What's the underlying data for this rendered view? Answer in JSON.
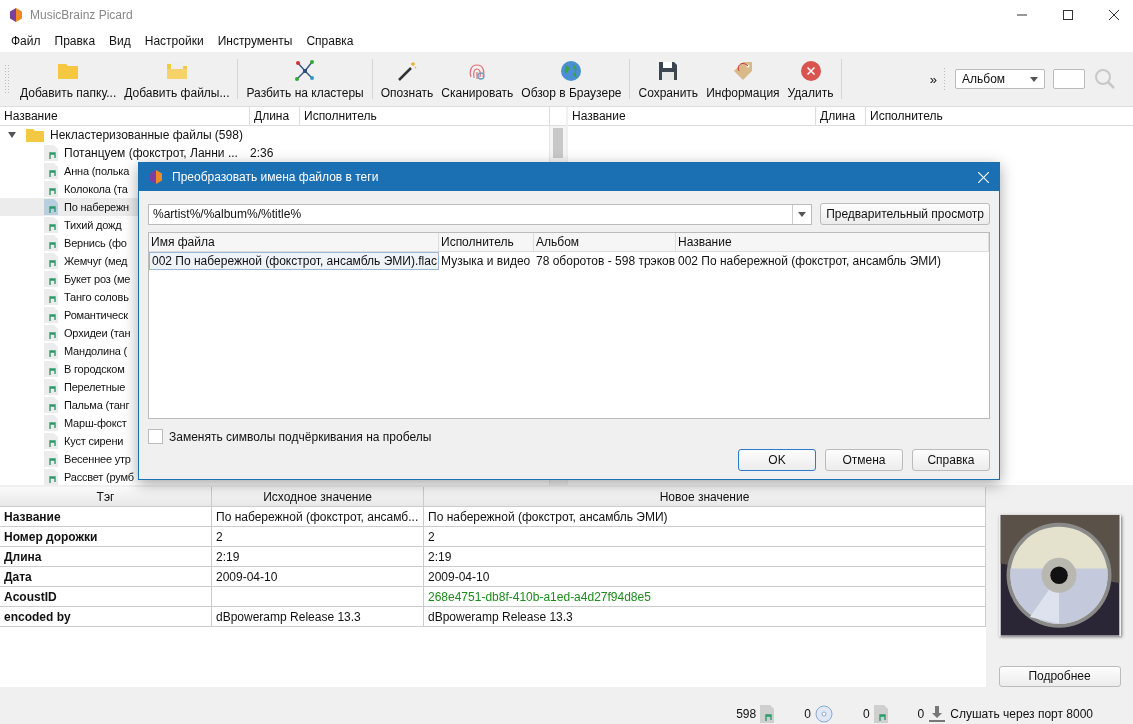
{
  "window": {
    "title": "MusicBrainz Picard"
  },
  "menu": [
    "Файл",
    "Правка",
    "Вид",
    "Настройки",
    "Инструменты",
    "Справка"
  ],
  "toolbar": [
    {
      "label": "Добавить папку...",
      "kind": "folder"
    },
    {
      "label": "Добавить файлы...",
      "kind": "files"
    },
    {
      "label": "Разбить на кластеры",
      "kind": "cluster"
    },
    {
      "label": "Опознать",
      "kind": "wand"
    },
    {
      "label": "Сканировать",
      "kind": "fingerprint"
    },
    {
      "label": "Обзор в Браузере",
      "kind": "globe"
    },
    {
      "label": "Сохранить",
      "kind": "save"
    },
    {
      "label": "Информация",
      "kind": "tag"
    },
    {
      "label": "Удалить",
      "kind": "remove"
    }
  ],
  "search": {
    "more": "»",
    "mode": "Альбом"
  },
  "left_pane": {
    "columns": [
      "Название",
      "Длина",
      "Исполнитель"
    ],
    "tree": {
      "label": "Некластеризованные файлы (598)",
      "expanded": true,
      "children": [
        {
          "title": "Потанцуем (фокстрот, Ланни ...",
          "length": "2:36",
          "selected": false
        },
        {
          "title": "Анна (полька",
          "selected": false
        },
        {
          "title": "Колокола (та",
          "selected": false
        },
        {
          "title": "По набережн",
          "selected": true
        },
        {
          "title": "Тихий дожд",
          "selected": false
        },
        {
          "title": "Вернись (фо",
          "selected": false
        },
        {
          "title": "Жемчуг (мед",
          "selected": false
        },
        {
          "title": "Букет роз (ме",
          "selected": false
        },
        {
          "title": "Танго соловь",
          "selected": false
        },
        {
          "title": "Романтическ",
          "selected": false
        },
        {
          "title": "Орхидеи (тан",
          "selected": false
        },
        {
          "title": "Мандолина (",
          "selected": false
        },
        {
          "title": "В городском",
          "selected": false
        },
        {
          "title": "Перелетные",
          "selected": false
        },
        {
          "title": "Пальма (танг",
          "selected": false
        },
        {
          "title": "Марш-фокст",
          "selected": false
        },
        {
          "title": "Куст сирени",
          "selected": false
        },
        {
          "title": "Весеннее утр",
          "selected": false
        },
        {
          "title": "Рассвет (румб",
          "selected": false
        }
      ]
    }
  },
  "right_pane": {
    "columns": [
      "Название",
      "Длина",
      "Исполнитель"
    ]
  },
  "dialog": {
    "title": "Преобразовать имена файлов в теги",
    "pattern": "%artist%/%album%/%title%",
    "preview_button": "Предварительный просмотр",
    "columns": [
      "Имя файла",
      "Исполнитель",
      "Альбом",
      "Название"
    ],
    "rows": [
      [
        "002 По набережной (фокстрот, ансамбль ЭМИ).flac",
        "Музыка и видео",
        "78 оборотов - 598 трэков",
        "002 По набережной (фокстрот, ансамбль ЭМИ)"
      ]
    ],
    "option": {
      "label": "Заменять символы подчёркивания на пробелы",
      "checked": false
    },
    "buttons": [
      "OK",
      "Отмена",
      "Справка"
    ]
  },
  "metadata": {
    "columns": [
      "Тэг",
      "Исходное значение",
      "Новое значение"
    ],
    "rows": [
      {
        "tag": "Название",
        "original": "По набережной (фокстрот, ансамб...",
        "new": "По набережной (фокстрот, ансамбль ЭМИ)",
        "changed": false
      },
      {
        "tag": "Номер дорожки",
        "original": "2",
        "new": "2",
        "changed": false
      },
      {
        "tag": "Длина",
        "original": "2:19",
        "new": "2:19",
        "changed": false
      },
      {
        "tag": "Дата",
        "original": "2009-04-10",
        "new": "2009-04-10",
        "changed": false
      },
      {
        "tag": "AcoustID",
        "new": "268e4751-db8f-410b-a1ed-a4d27f94d8e5",
        "changed": true
      },
      {
        "tag": "encoded by",
        "original": "dBpoweramp Release 13.3",
        "new": "dBpoweramp Release 13.3",
        "changed": false
      }
    ]
  },
  "details_button": "Подробнее",
  "status_bar": {
    "counts": [
      {
        "count": "598",
        "kind": "file"
      },
      {
        "count": "0",
        "kind": "disc"
      },
      {
        "count": "0",
        "kind": "file"
      },
      {
        "count": "0",
        "kind": "download"
      }
    ],
    "listening": "Слушать через порт 8000"
  }
}
